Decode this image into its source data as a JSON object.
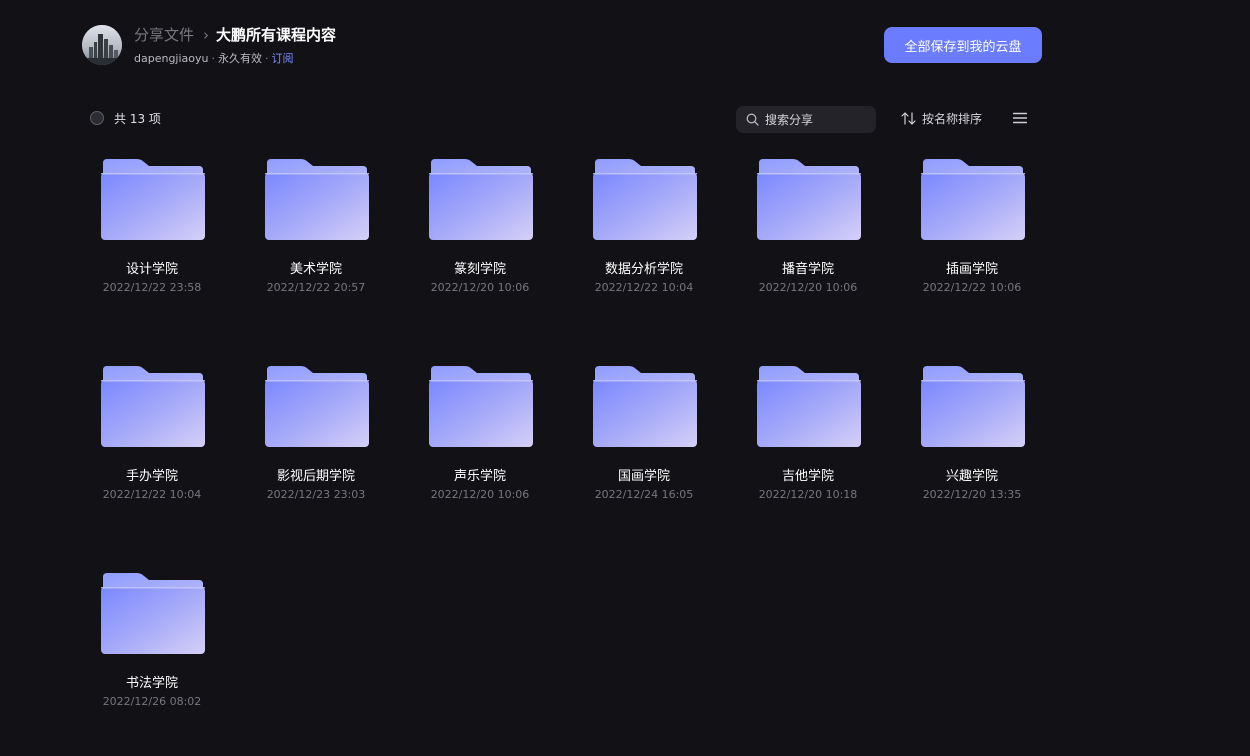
{
  "header": {
    "breadcrumb_parent": "分享文件",
    "breadcrumb_separator": "›",
    "title": "大鹏所有课程内容",
    "owner": "dapengjiaoyu",
    "validity": "永久有效",
    "subscribe": "订阅",
    "save_all_label": "全部保存到我的云盘"
  },
  "toolbar": {
    "count_label": "共 13 项",
    "search_placeholder": "搜索分享",
    "sort_label": "按名称排序"
  },
  "colors": {
    "background": "#121116",
    "accent": "#6b7cff",
    "subscribe_link": "#7f8cff"
  },
  "items": [
    {
      "name": "设计学院",
      "date": "2022/12/22 23:58",
      "icon": "folder-icon"
    },
    {
      "name": "美术学院",
      "date": "2022/12/22 20:57",
      "icon": "folder-icon"
    },
    {
      "name": "篆刻学院",
      "date": "2022/12/20 10:06",
      "icon": "folder-icon"
    },
    {
      "name": "数据分析学院",
      "date": "2022/12/22 10:04",
      "icon": "folder-icon"
    },
    {
      "name": "播音学院",
      "date": "2022/12/20 10:06",
      "icon": "folder-icon"
    },
    {
      "name": "插画学院",
      "date": "2022/12/22 10:06",
      "icon": "folder-icon"
    },
    {
      "name": "手办学院",
      "date": "2022/12/22 10:04",
      "icon": "folder-icon"
    },
    {
      "name": "影视后期学院",
      "date": "2022/12/23 23:03",
      "icon": "folder-icon"
    },
    {
      "name": "声乐学院",
      "date": "2022/12/20 10:06",
      "icon": "folder-icon"
    },
    {
      "name": "国画学院",
      "date": "2022/12/24 16:05",
      "icon": "folder-icon"
    },
    {
      "name": "吉他学院",
      "date": "2022/12/20 10:18",
      "icon": "folder-icon"
    },
    {
      "name": "兴趣学院",
      "date": "2022/12/20 13:35",
      "icon": "folder-icon"
    },
    {
      "name": "书法学院",
      "date": "2022/12/26 08:02",
      "icon": "folder-icon"
    }
  ]
}
